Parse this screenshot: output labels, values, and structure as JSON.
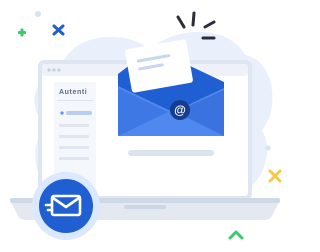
{
  "laptop": {
    "brand_label": "Autenti"
  },
  "envelope": {
    "symbol": "@"
  },
  "colors": {
    "accent": "#1f5fd1",
    "accent_light": "#5b8ff0",
    "blob": "#e7effd",
    "yellow": "#f5c945",
    "green": "#3ec96a",
    "sparkle": "#2d2d3a"
  },
  "icons": [
    "mail-icon",
    "at-icon",
    "sparkle-icon",
    "plus-icon",
    "star-icon"
  ]
}
